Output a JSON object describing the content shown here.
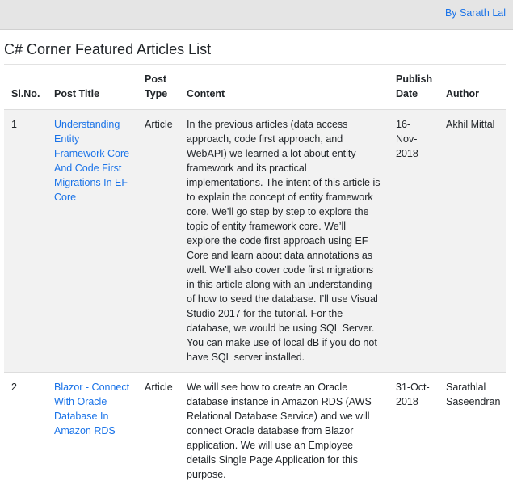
{
  "header": {
    "author_link": "By Sarath Lal"
  },
  "page_title": "C# Corner Featured Articles List",
  "table": {
    "columns": [
      "Sl.No.",
      "Post Title",
      "Post Type",
      "Content",
      "Publish Date",
      "Author"
    ],
    "rows": [
      {
        "slno": "1",
        "title": "Understanding Entity Framework Core And Code First Migrations In EF Core",
        "type": "Article",
        "content": "In the previous articles (data access approach, code first approach, and WebAPI) we learned a lot about entity framework and its practical implementations. The intent of this article is to explain the concept of entity framework core. We’ll go step by step to explore the topic of entity framework core. We’ll explore the code first approach using EF Core and learn about data annotations as well. We’ll also cover code first migrations in this article along with an understanding of how to seed the database. I’ll use Visual Studio 2017 for the tutorial. For the database, we would be using SQL Server. You can make use of local dB if you do not have SQL server installed.",
        "date": "16-Nov-2018",
        "author": "Akhil Mittal"
      },
      {
        "slno": "2",
        "title": "Blazor - Connect With Oracle Database In Amazon RDS",
        "type": "Article",
        "content": "We will see how to create an Oracle database instance in Amazon RDS (AWS Relational Database Service) and we will connect Oracle database from Blazor application. We will use an Employee details Single Page Application for this purpose.",
        "date": "31-Oct-2018",
        "author": "Sarathlal Saseendran"
      }
    ]
  }
}
